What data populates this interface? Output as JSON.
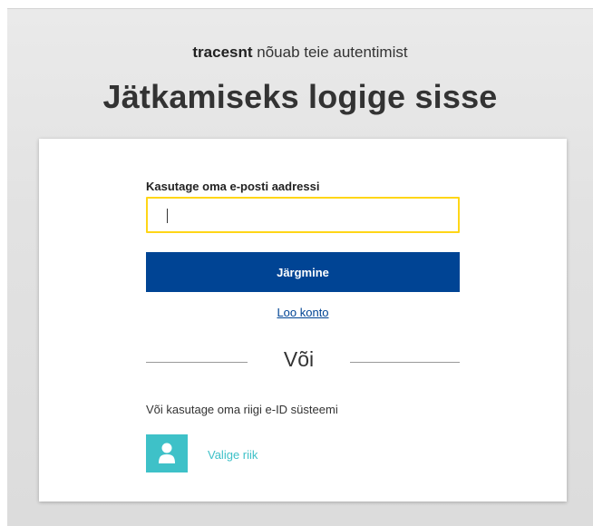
{
  "header": {
    "app_name": "tracesnt",
    "subtitle_suffix": " nõuab teie autentimist",
    "title": "Jätkamiseks logige sisse"
  },
  "login": {
    "email_label": "Kasutage oma e-posti aadressi",
    "email_value": "",
    "next_button_label": "Järgmine",
    "create_account_label": "Loo konto"
  },
  "divider": {
    "or_label": "Või"
  },
  "eid": {
    "text": "Või kasutage oma riigi e-ID süsteemi",
    "choose_country_label": "Valige riik",
    "icon": "user-icon"
  },
  "colors": {
    "primary_button": "#004494",
    "input_focus_border": "#ffd617",
    "eid_accent": "#3ec1c8"
  }
}
